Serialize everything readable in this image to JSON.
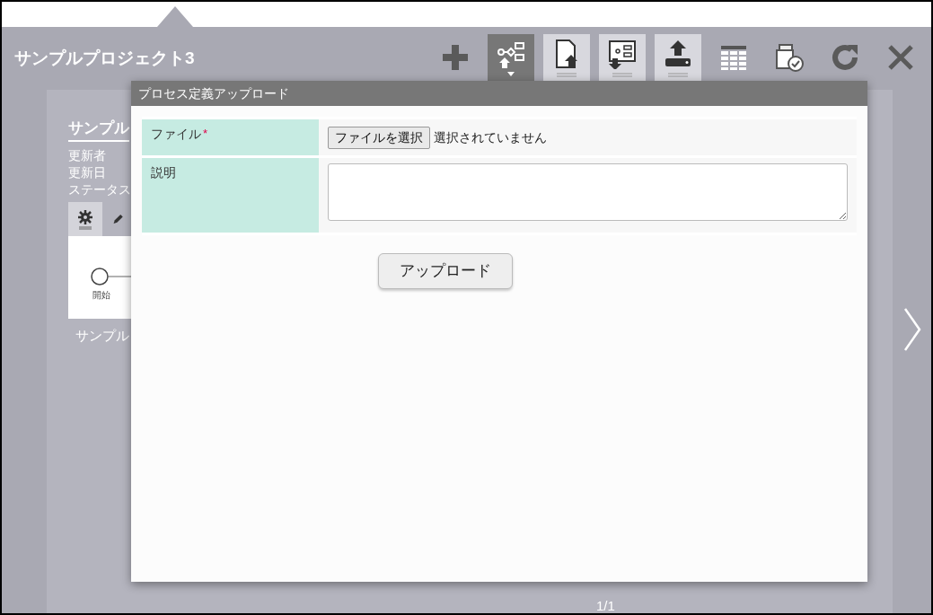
{
  "window": {
    "title": "サンプルプロジェクト3"
  },
  "toolbar": [
    {
      "kind": "add",
      "selected": false,
      "raised": false
    },
    {
      "kind": "process-upload",
      "selected": true,
      "raised": false
    },
    {
      "kind": "file-upload",
      "selected": false,
      "raised": true
    },
    {
      "kind": "diagram-download",
      "selected": false,
      "raised": true
    },
    {
      "kind": "tray-upload",
      "selected": false,
      "raised": true
    },
    {
      "kind": "table",
      "selected": false,
      "raised": false
    },
    {
      "kind": "copy-check",
      "selected": false,
      "raised": false
    },
    {
      "kind": "refresh",
      "selected": false,
      "raised": false
    },
    {
      "kind": "close",
      "selected": false,
      "raised": false
    }
  ],
  "project_card": {
    "title": "サンプル",
    "fields": [
      "更新者",
      "更新日",
      "ステータス"
    ],
    "tabs": [
      {
        "kind": "settings",
        "selected": true
      },
      {
        "kind": "edit",
        "selected": false
      }
    ],
    "diagram": {
      "start_label": "開始"
    },
    "description": "サンプル"
  },
  "pager": "1/1",
  "dialog": {
    "title": "プロセス定義アップロード",
    "fields": [
      {
        "kind": "file",
        "label": "ファイル",
        "required_mark": "*",
        "button": "ファイルを選択",
        "status": "選択されていません"
      },
      {
        "kind": "textarea",
        "label": "説明"
      }
    ],
    "submit": "アップロード"
  }
}
